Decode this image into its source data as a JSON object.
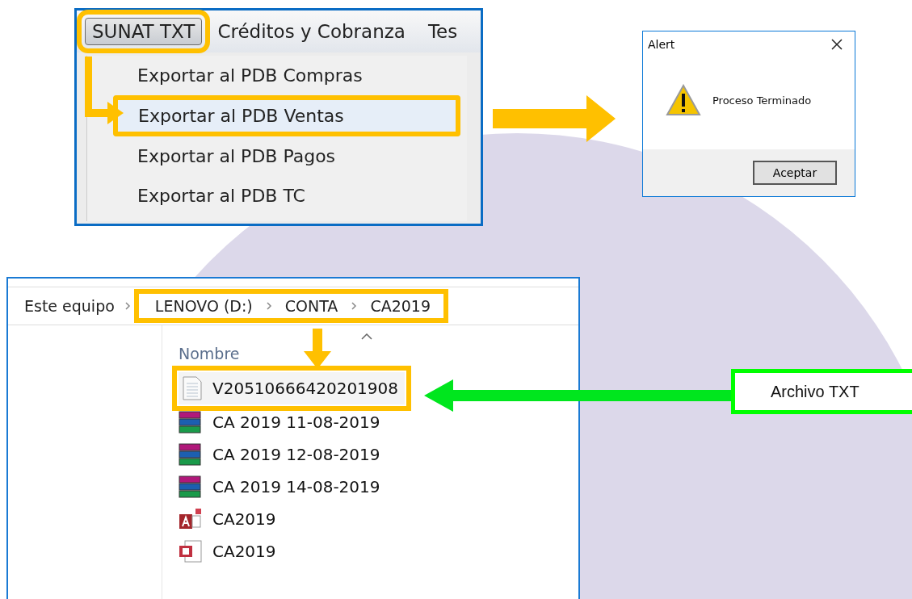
{
  "menu_window": {
    "menu_bar": [
      {
        "label": "SUNAT TXT",
        "selected": true
      },
      {
        "label": "Créditos y Cobranza",
        "selected": false
      },
      {
        "label": "Tes",
        "selected": false
      }
    ],
    "menu_items": [
      {
        "label": "Exportar al PDB Compras",
        "selected": false
      },
      {
        "label": "Exportar al PDB Ventas",
        "selected": true
      },
      {
        "label": "Exportar al PDB Pagos",
        "selected": false
      },
      {
        "label": "Exportar al PDB TC",
        "selected": false
      }
    ]
  },
  "alert": {
    "title": "Alert",
    "message": "Proceso Terminado",
    "button": "Aceptar"
  },
  "explorer": {
    "breadcrumb": [
      "Este equipo",
      "LENOVO (D:)",
      "CONTA",
      "CA2019"
    ],
    "column": "Nombre",
    "files": [
      {
        "name": "V20510666420201908",
        "kind": "text",
        "selected": true
      },
      {
        "name": "CA 2019 11-08-2019",
        "kind": "archive",
        "selected": false
      },
      {
        "name": "CA 2019 12-08-2019",
        "kind": "archive",
        "selected": false
      },
      {
        "name": "CA 2019 14-08-2019",
        "kind": "archive",
        "selected": false
      },
      {
        "name": "CA2019",
        "kind": "database",
        "selected": false
      },
      {
        "name": "CA2019",
        "kind": "publication",
        "selected": false
      }
    ]
  },
  "callout": "Archivo TXT"
}
